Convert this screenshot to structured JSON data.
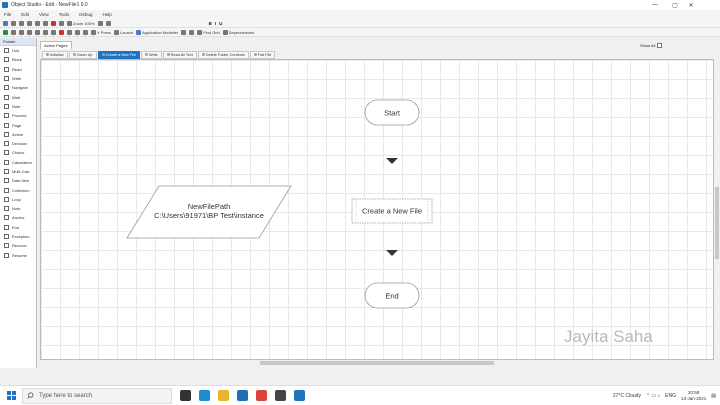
{
  "window": {
    "title": "Object Studio - Edit - NewFile1 9.0",
    "controls": [
      "—",
      "▢",
      "✕"
    ]
  },
  "menu": [
    "File",
    "Edit",
    "View",
    "Tools",
    "Debug",
    "Help"
  ],
  "toolbar1": [
    {
      "icon": "save-icon",
      "label": "",
      "color": "#4a7bc8"
    },
    {
      "icon": "undo-icon",
      "label": "",
      "color": "#777777"
    },
    {
      "icon": "redo-icon",
      "label": "",
      "color": "#777777"
    },
    {
      "icon": "cut-icon",
      "label": "",
      "color": "#777777"
    },
    {
      "icon": "copy-icon",
      "label": "",
      "color": "#777777"
    },
    {
      "icon": "paste-icon",
      "label": "",
      "color": "#777777"
    },
    {
      "icon": "delete-icon",
      "label": "",
      "color": "#cc3333"
    },
    {
      "icon": "find-icon",
      "label": "",
      "color": "#777777"
    },
    {
      "icon": "zoom-icon",
      "label": "Zoom 100%",
      "color": "#777777"
    },
    {
      "icon": "zoom-in-icon",
      "label": "",
      "color": "#777777"
    },
    {
      "icon": "zoom-out-icon",
      "label": "",
      "color": "#777777"
    }
  ],
  "toolbar1_font": [
    "B",
    "I",
    "U"
  ],
  "toolbar2": [
    {
      "icon": "play-icon",
      "label": "",
      "color": "#2e8b3a"
    },
    {
      "icon": "pause-icon",
      "label": "",
      "color": "#777777"
    },
    {
      "icon": "stop-icon",
      "label": "",
      "color": "#777777"
    },
    {
      "icon": "step-icon",
      "label": "",
      "color": "#777777"
    },
    {
      "icon": "step-over-icon",
      "label": "",
      "color": "#777777"
    },
    {
      "icon": "step-out-icon",
      "label": "",
      "color": "#777777"
    },
    {
      "icon": "reset-icon",
      "label": "",
      "color": "#777777"
    },
    {
      "icon": "breakpoint-icon",
      "label": "",
      "color": "#cc3333"
    },
    {
      "icon": "validate-icon",
      "label": "",
      "color": "#777777"
    },
    {
      "icon": "process-icon",
      "label": "",
      "color": "#777777"
    },
    {
      "icon": "arrow-icon",
      "label": "",
      "color": "#777777"
    },
    {
      "icon": "x-icon",
      "label": "X Press",
      "color": "#777777"
    },
    {
      "icon": "launch-icon",
      "label": "Launch",
      "color": "#777777"
    },
    {
      "icon": "app-modeller-icon",
      "label": "Application Modeller",
      "color": "#4a7bc8"
    },
    {
      "icon": "link-icon",
      "label": "",
      "color": "#777777"
    },
    {
      "icon": "grid-icon",
      "label": "",
      "color": "#777777"
    },
    {
      "icon": "search-icon",
      "label": "Find Grid",
      "color": "#777777"
    },
    {
      "icon": "dependencies-icon",
      "label": "Dependencies",
      "color": "#777777"
    }
  ],
  "sidebar": {
    "header": "Pointer",
    "items": [
      "Link",
      "Block",
      "Read",
      "Write",
      "Navigate",
      "Wait",
      "Note",
      "Process",
      "Page",
      "Action",
      "Decision",
      "Choice",
      "Calculation",
      "Multi Calc",
      "Data Item",
      "Collection",
      "Loop",
      "Note",
      "Anchor",
      "End",
      "Exception",
      "Recover",
      "Resume"
    ]
  },
  "page_tab": "Action Pages",
  "show_all": "Show All",
  "subtabs": [
    {
      "label": "Initialise",
      "active": false
    },
    {
      "label": "Clean Up",
      "active": false
    },
    {
      "label": "Create a New File",
      "active": true
    },
    {
      "label": "Write",
      "active": false
    },
    {
      "label": "Read All Text",
      "active": false
    },
    {
      "label": "Delete Folder Contents",
      "active": false
    },
    {
      "label": "Flat File",
      "active": false
    }
  ],
  "flow": {
    "start": "Start",
    "action": "Create a New File",
    "end": "End",
    "data_item_line1": "NewFilePath",
    "data_item_line2": "C:\\Users\\91971\\BP Test\\instance"
  },
  "watermark": "Jayita Saha",
  "taskbar": {
    "search_placeholder": "Type here to search",
    "weather": "27°C Cloudy",
    "lang": "ENG",
    "time": "20:58",
    "date": "13-Jan-2021",
    "apps": [
      {
        "icon": "task-view-icon",
        "color": "#333333"
      },
      {
        "icon": "edge-icon",
        "color": "#1b8ccf"
      },
      {
        "icon": "explorer-icon",
        "color": "#e9b330"
      },
      {
        "icon": "mail-icon",
        "color": "#1e6fb5"
      },
      {
        "icon": "chrome-icon",
        "color": "#db4437"
      },
      {
        "icon": "store-icon",
        "color": "#444444"
      },
      {
        "icon": "blueprism-icon",
        "color": "#1e73be"
      }
    ]
  },
  "colors": {
    "accent": "#1e73be",
    "canvas": "#ffffff",
    "grid": "#e8e8e8"
  }
}
